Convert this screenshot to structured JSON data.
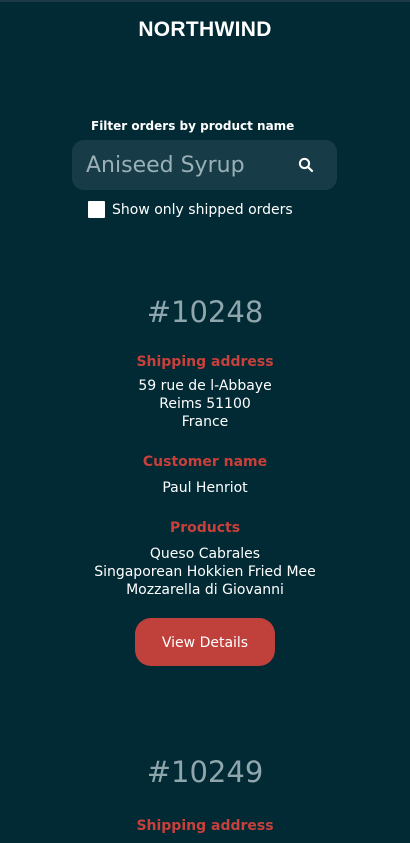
{
  "brand": "NORTHWIND",
  "filter": {
    "label": "Filter orders by product name",
    "value": "Aniseed Syrup",
    "checkbox_label": "Show only shipped orders"
  },
  "labels": {
    "shipping_address": "Shipping address",
    "customer_name": "Customer name",
    "products": "Products",
    "view_details": "View Details"
  },
  "orders": [
    {
      "id": "#10248",
      "address": [
        "59 rue de l-Abbaye",
        "Reims 51100",
        "France"
      ],
      "customer": "Paul Henriot",
      "products": [
        "Queso Cabrales",
        "Singaporean Hokkien Fried Mee",
        "Mozzarella di Giovanni"
      ]
    },
    {
      "id": "#10249"
    }
  ],
  "colors": {
    "background": "#012a35",
    "accent": "#c0413b",
    "input_bg": "#173c47",
    "muted": "#8fa6ac"
  }
}
